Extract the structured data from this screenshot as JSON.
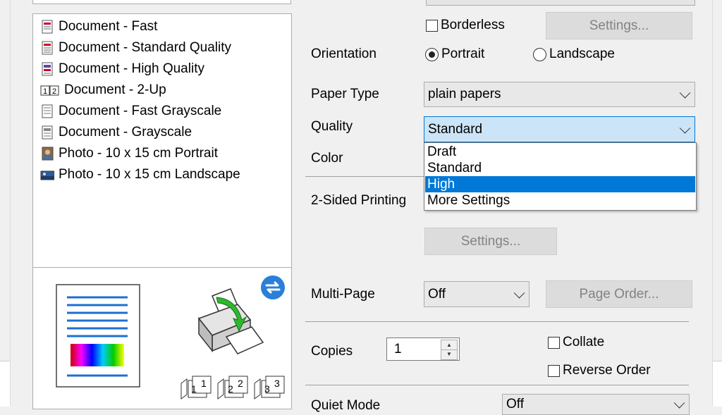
{
  "presets": [
    {
      "label": "Document - Fast",
      "icon": "document-fast-icon"
    },
    {
      "label": "Document - Standard Quality",
      "icon": "document-standard-icon"
    },
    {
      "label": "Document - High Quality",
      "icon": "document-high-icon"
    },
    {
      "label": "Document - 2-Up",
      "icon": "two-up-icon"
    },
    {
      "label": "Document - Fast Grayscale",
      "icon": "document-grayscale-fast-icon"
    },
    {
      "label": "Document - Grayscale",
      "icon": "document-grayscale-icon"
    },
    {
      "label": "Photo - 10 x 15 cm Portrait",
      "icon": "photo-portrait-icon"
    },
    {
      "label": "Photo - 10 x 15 cm Landscape",
      "icon": "photo-landscape-icon"
    }
  ],
  "two_up_glyph": "1 2",
  "borderless": {
    "label": "Borderless",
    "checked": false,
    "settings_label": "Settings..."
  },
  "orientation": {
    "label": "Orientation",
    "portrait": "Portrait",
    "landscape": "Landscape",
    "selected": "Portrait"
  },
  "paper_type": {
    "label": "Paper Type",
    "value": "plain papers"
  },
  "quality": {
    "label": "Quality",
    "value": "Standard",
    "options": [
      "Draft",
      "Standard",
      "High",
      "More Settings"
    ],
    "highlighted": "High"
  },
  "color": {
    "label": "Color"
  },
  "two_sided": {
    "label": "2-Sided Printing",
    "settings_label": "Settings..."
  },
  "multi_page": {
    "label": "Multi-Page",
    "value": "Off",
    "page_order_label": "Page Order..."
  },
  "copies": {
    "label": "Copies",
    "value": "1",
    "collate": "Collate",
    "reverse_order": "Reverse Order"
  },
  "quiet_mode": {
    "label": "Quiet Mode",
    "value": "Off"
  },
  "page_stack_labels": [
    "1",
    "2",
    "3"
  ],
  "colors": {
    "accent": "#0078d7",
    "focus_bg": "#cce4f7"
  }
}
